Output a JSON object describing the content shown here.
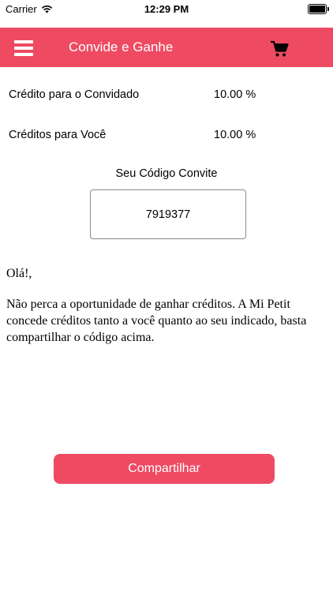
{
  "status_bar": {
    "carrier": "Carrier",
    "time": "12:29 PM",
    "battery_level": 1.0
  },
  "navbar": {
    "title": "Convide e Ganhe",
    "menu_icon": "hamburger-menu-icon",
    "cart_icon": "shopping-cart-icon"
  },
  "credits": {
    "guest_label": "Crédito para o Convidado",
    "guest_value": "10.00 %",
    "you_label": "Créditos para Você",
    "you_value": "10.00 %"
  },
  "invite_code": {
    "title": "Seu Código Convite",
    "code": "7919377"
  },
  "message": {
    "greeting": "Olá!,",
    "body": "Não perca a oportunidade de ganhar créditos. A Mi Petit concede créditos tanto a você quanto ao seu indicado, basta compartilhar o código acima."
  },
  "share_button": {
    "label": "Compartilhar"
  },
  "colors": {
    "accent": "#ee4b63",
    "box_border": "#8a8a8a"
  }
}
